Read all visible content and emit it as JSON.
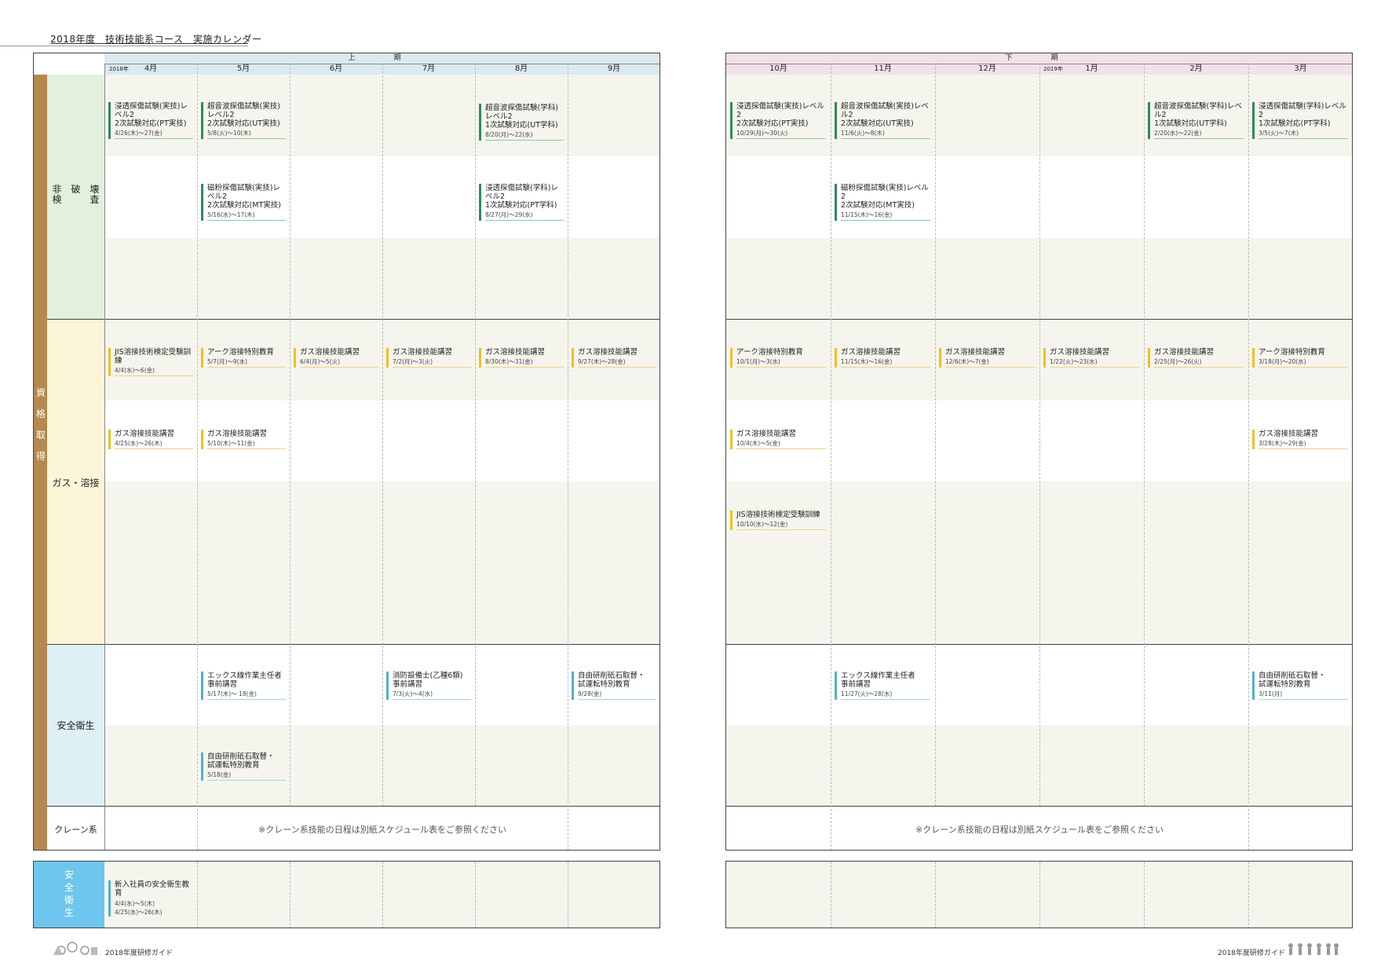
{
  "page": {
    "title": "2018年度　技術技能系コース　実施カレンダー",
    "footer_left": "2018年度研修ガイド",
    "footer_right": "2018年度研修ガイド"
  },
  "colors": {
    "ndt_bg": "#e3f0dc",
    "weld_bg": "#fdf5d8",
    "safety_bg": "#dff0f4",
    "side_strip": "#b5884f",
    "general_safety": "#6ec6ee",
    "header_left": "#dce9f0",
    "header_right": "#f2e1e8",
    "shade": "#f5f5ee"
  },
  "header": {
    "first_half": "上　期",
    "second_half": "下　期",
    "year_2018": "2018年",
    "year_2019": "2019年",
    "months_left": [
      "4月",
      "5月",
      "6月",
      "7月",
      "8月",
      "9月"
    ],
    "months_right": [
      "10月",
      "11月",
      "12月",
      "1月",
      "2月",
      "3月"
    ]
  },
  "categories": {
    "side_label": [
      "資",
      "格",
      "取",
      "得"
    ],
    "ndt_line1": "非　破　壊",
    "ndt_line2": "検　　　査",
    "welding": "ガス・溶接",
    "safety": "安全衛生",
    "crane": "クレーン系",
    "general_safety": [
      "安",
      "全",
      "衛",
      "生"
    ]
  },
  "crane_note_left": "※クレーン系技能の日程は別紙スケジュール表をご参照ください",
  "crane_note_right": "※クレーン系技能の日程は別紙スケジュール表をご参照ください",
  "courses": {
    "ndt": [
      {
        "l1": "浸透探傷試験(実技)レベル2",
        "l2": "2次試験対応(PT実技)",
        "date": "4/26(木)～27(金)"
      },
      {
        "l1": "超音波探傷試験(実技)レベル2",
        "l2": "2次試験対応(UT実技)",
        "date": "5/8(火)～10(木)"
      },
      {
        "l1": "超音波探傷試験(学科)レベル2",
        "l2": "1次試験対応(UT学科)",
        "date": "8/20(月)～22(水)"
      },
      {
        "l1": "磁粉探傷試験(実技)レベル2",
        "l2": "2次試験対応(MT実技)",
        "date": "5/16(水)～17(木)"
      },
      {
        "l1": "浸透探傷試験(学科)レベル2",
        "l2": "1次試験対応(PT学科)",
        "date": "8/27(月)～29(水)"
      },
      {
        "l1": "浸透探傷試験(実技)レベル2",
        "l2": "2次試験対応(PT実技)",
        "date": "10/29(月)～30(火)"
      },
      {
        "l1": "超音波探傷試験(実技)レベル2",
        "l2": "2次試験対応(UT実技)",
        "date": "11/6(火)～8(木)"
      },
      {
        "l1": "超音波探傷試験(学科)レベル2",
        "l2": "1次試験対応(UT学科)",
        "date": "2/20(水)～22(金)"
      },
      {
        "l1": "浸透探傷試験(学科)レベル2",
        "l2": "1次試験対応(PT学科)",
        "date": "3/5(火)～7(木)"
      },
      {
        "l1": "磁粉探傷試験(実技)レベル2",
        "l2": "2次試験対応(MT実技)",
        "date": "11/15(木)～16(金)"
      }
    ],
    "weld": [
      {
        "l1": "JIS溶接技術検定受験訓練",
        "date": "4/4(水)～6(金)"
      },
      {
        "l1": "アーク溶接特別教育",
        "date": "5/7(月)～9(水)"
      },
      {
        "l1": "ガス溶接技能講習",
        "date": "6/4(月)～5(火)"
      },
      {
        "l1": "ガス溶接技能講習",
        "date": "7/2(月)～3(火)"
      },
      {
        "l1": "ガス溶接技能講習",
        "date": "8/30(木)～31(金)"
      },
      {
        "l1": "ガス溶接技能講習",
        "date": "9/27(木)～28(金)"
      },
      {
        "l1": "ガス溶接技能講習",
        "date": "4/25(水)～26(木)"
      },
      {
        "l1": "ガス溶接技能講習",
        "date": "5/10(木)～11(金)"
      },
      {
        "l1": "アーク溶接特別教育",
        "date": "10/1(月)～3(水)"
      },
      {
        "l1": "ガス溶接技能講習",
        "date": "11/15(木)～16(金)"
      },
      {
        "l1": "ガス溶接技能講習",
        "date": "12/6(木)～7(金)"
      },
      {
        "l1": "ガス溶接技能講習",
        "date": "1/22(火)～23(水)"
      },
      {
        "l1": "ガス溶接技能講習",
        "date": "2/25(月)～26(火)"
      },
      {
        "l1": "アーク溶接特別教育",
        "date": "3/18(月)～20(水)"
      },
      {
        "l1": "ガス溶接技能講習",
        "date": "10/4(木)～5(金)"
      },
      {
        "l1": "ガス溶接技能講習",
        "date": "3/28(木)～29(金)"
      },
      {
        "l1": "JIS溶接技術検定受験訓練",
        "date": "10/10(水)～12(金)"
      }
    ],
    "safety": [
      {
        "l1": "エックス線作業主任者",
        "l2": "事前講習",
        "date": "5/17(木)～ 18(金)"
      },
      {
        "l1": "消防設備士(乙種6類)",
        "l2": "事前講習",
        "date": "7/3(火)～4(水)"
      },
      {
        "l1": "自由研削砥石取替・",
        "l2": "試運転特別教育",
        "date": "9/28(金)"
      },
      {
        "l1": "自由研削砥石取替・",
        "l2": "試運転特別教育",
        "date": "5/18(金)"
      },
      {
        "l1": "エックス線作業主任者",
        "l2": "事前講習",
        "date": "11/27(火)～28(水)"
      },
      {
        "l1": "自由研削砥石取替・",
        "l2": "試運転特別教育",
        "date": "3/11(月)"
      }
    ],
    "general": {
      "l1": "新入社員の安全衛生教育",
      "date1": "4/4(水)～5(木)",
      "date2": "4/25(水)～26(木)"
    }
  }
}
